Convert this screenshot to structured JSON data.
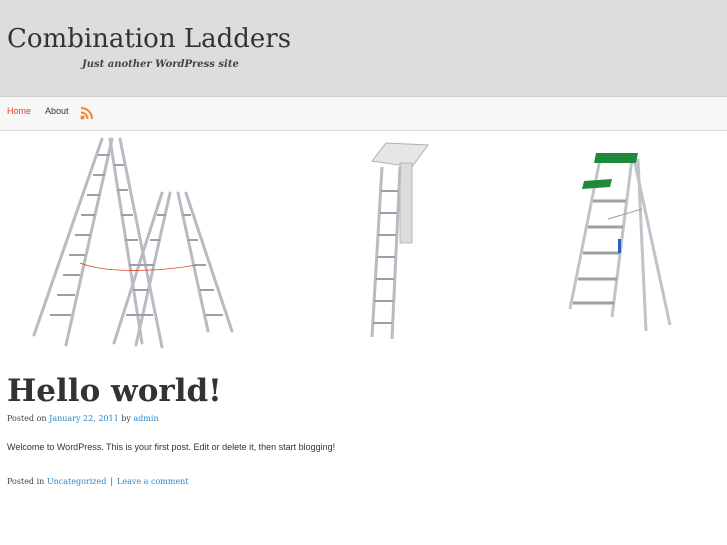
{
  "site": {
    "title": "Combination Ladders",
    "description": "Just another WordPress site"
  },
  "nav": {
    "items": [
      {
        "label": "Home"
      },
      {
        "label": "About"
      }
    ],
    "rss_icon": "rss-icon",
    "active_color": "#d9442c"
  },
  "post": {
    "title": "Hello world!",
    "posted_on_label": "Posted on",
    "date": "January 22, 2011",
    "by_label": "by",
    "author": "admin",
    "excerpt": "Welcome to WordPress. This is your first post. Edit or delete it, then start blogging!",
    "posted_in_label": "Posted in",
    "category": "Uncategorized",
    "separator": "|",
    "comments_link": "Leave a comment"
  },
  "colors": {
    "header_bg": "#dddddd",
    "link": "#2e87c9"
  }
}
